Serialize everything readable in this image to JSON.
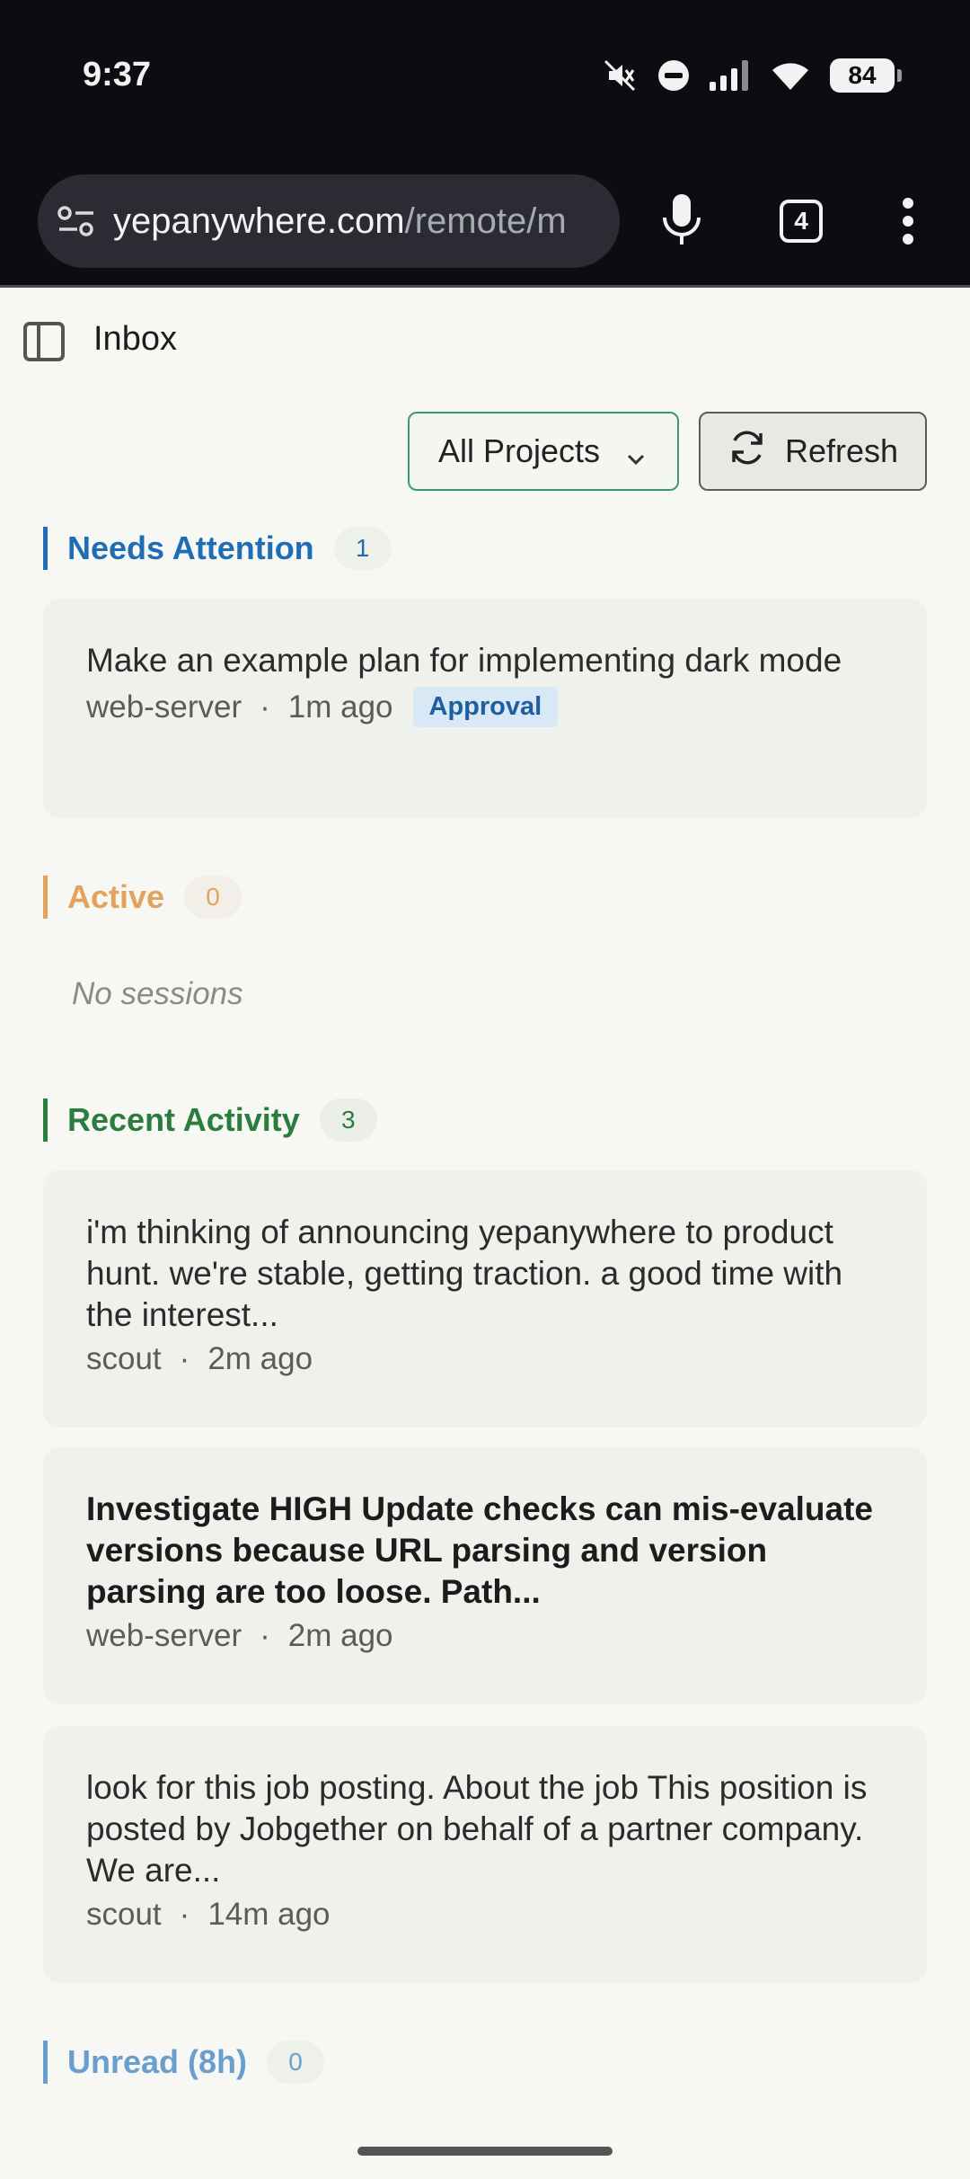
{
  "status_bar": {
    "time": "9:37",
    "battery": "84",
    "icons": [
      "mute-icon",
      "do-not-disturb-icon",
      "signal-icon",
      "wifi-icon",
      "battery-icon"
    ]
  },
  "browser": {
    "url_host": "yepanywhere.com",
    "url_path": "/remote/m",
    "tab_count": "4"
  },
  "header": {
    "title": "Inbox"
  },
  "filters": {
    "project_select": "All Projects",
    "refresh_label": "Refresh"
  },
  "sections": {
    "needs_attention": {
      "title": "Needs Attention",
      "count": "1",
      "color": "#1f6db5",
      "items": [
        {
          "title": "Make an example plan for implementing dark mode",
          "project": "web-server",
          "time": "1m ago",
          "badge": "Approval"
        }
      ]
    },
    "active": {
      "title": "Active",
      "count": "0",
      "color": "#e2a35e",
      "empty": "No sessions"
    },
    "recent_activity": {
      "title": "Recent Activity",
      "count": "3",
      "color": "#2a7d3e",
      "items": [
        {
          "title": "i'm thinking of announcing yepanywhere to product hunt. we're stable, getting traction. a good time with the interest...",
          "project": "scout",
          "time": "2m ago"
        },
        {
          "title": "Investigate HIGH Update checks can mis-evaluate versions because URL parsing and version parsing are too loose. Path...",
          "project": "web-server",
          "time": "2m ago"
        },
        {
          "title": "look for this job posting. About the job This position is posted by Jobgether on behalf of a partner company. We are...",
          "project": "scout",
          "time": "14m ago"
        }
      ]
    },
    "unread": {
      "title": "Unread (8h)",
      "count": "0",
      "color": "#6a9fcd"
    }
  }
}
